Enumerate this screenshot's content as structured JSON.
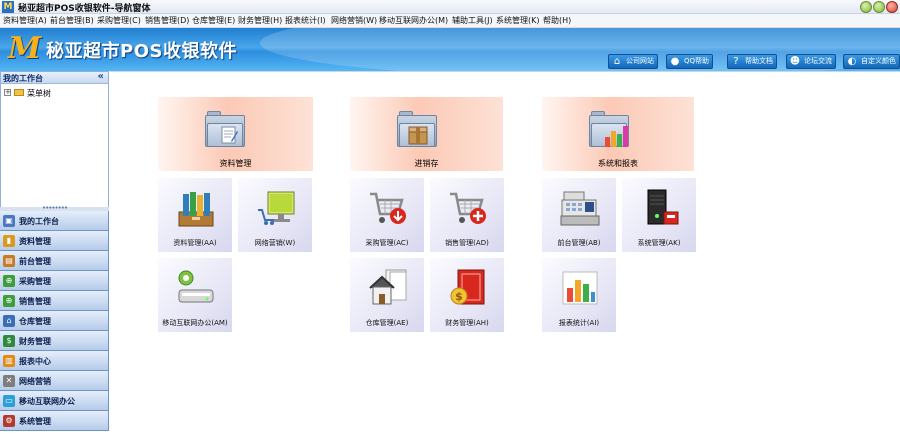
{
  "window": {
    "title": "秘亚超市POS收银软件-导航窗体",
    "logo_letter": "M"
  },
  "menu": [
    "资料管理(A)",
    "前台管理(B)",
    "采购管理(C)",
    "销售管理(D)",
    "仓库管理(E)",
    "财务管理(H)",
    "报表统计(I)",
    "网络营销(W)",
    "移动互联网办公(M)",
    "辅助工具(J)",
    "系统管理(K)",
    "帮助(H)"
  ],
  "banner": {
    "logo_letter": "M",
    "title": "秘亚超市POS收银软件",
    "links": [
      {
        "label": "公司网站",
        "icon": "home-icon"
      },
      {
        "label": "QQ帮助",
        "icon": "qq-penguin-icon"
      },
      {
        "label": "帮助文档",
        "icon": "help-icon"
      },
      {
        "label": "论坛交流",
        "icon": "forum-users-icon"
      },
      {
        "label": "自定义颜色",
        "icon": "palette-icon"
      }
    ]
  },
  "workbench": {
    "title": "我的工作台",
    "collapse": "«",
    "tree_root": "菜单树",
    "tree_expand": "+",
    "splitter_dots": "••••••••"
  },
  "nav": [
    {
      "label": "我的工作台",
      "icon": "desktop-icon",
      "color": "#4a78c4",
      "glyph": "▣"
    },
    {
      "label": "资料管理",
      "icon": "book-icon",
      "color": "#d99a1e",
      "glyph": "▮"
    },
    {
      "label": "前台管理",
      "icon": "cash-register-icon",
      "color": "#c77b28",
      "glyph": "▤"
    },
    {
      "label": "采购管理",
      "icon": "cart-icon",
      "color": "#3f9c3a",
      "glyph": "⊕"
    },
    {
      "label": "销售管理",
      "icon": "cart-sale-icon",
      "color": "#3f9c3a",
      "glyph": "⊕"
    },
    {
      "label": "仓库管理",
      "icon": "warehouse-icon",
      "color": "#3b6db8",
      "glyph": "⌂"
    },
    {
      "label": "财务管理",
      "icon": "finance-icon",
      "color": "#2f8a3d",
      "glyph": "$"
    },
    {
      "label": "报表中心",
      "icon": "bar-chart-icon",
      "color": "#e28b1a",
      "glyph": "▥"
    },
    {
      "label": "网络营销",
      "icon": "network-icon",
      "color": "#7d7d7d",
      "glyph": "✕"
    },
    {
      "label": "移动互联网办公",
      "icon": "mobile-office-icon",
      "color": "#2c9fd6",
      "glyph": "▭"
    },
    {
      "label": "系统管理",
      "icon": "system-icon",
      "color": "#b23b2e",
      "glyph": "⚙"
    }
  ],
  "groups": [
    {
      "label": "资料管理",
      "icon": "folder-documents-icon"
    },
    {
      "label": "进销存",
      "icon": "folder-box-icon"
    },
    {
      "label": "系统和报表",
      "icon": "folder-chart-icon"
    }
  ],
  "tiles": [
    {
      "label": "资料管理(AA)",
      "icon": "binders-icon"
    },
    {
      "label": "网络营销(W)",
      "icon": "monitor-cart-icon"
    },
    {
      "label": "采购管理(AC)",
      "icon": "cart-down-icon"
    },
    {
      "label": "销售管理(AD)",
      "icon": "cart-plus-icon"
    },
    {
      "label": "前台管理(AB)",
      "icon": "cash-register-icon"
    },
    {
      "label": "系统管理(AK)",
      "icon": "server-icon"
    },
    {
      "label": "移动互联网办公(AM)",
      "icon": "drive-sync-icon"
    },
    {
      "label": "仓库管理(AE)",
      "icon": "house-document-icon"
    },
    {
      "label": "财务管理(AH)",
      "icon": "money-book-icon"
    },
    {
      "label": "报表统计(AI)",
      "icon": "bar-chart-icon"
    }
  ]
}
